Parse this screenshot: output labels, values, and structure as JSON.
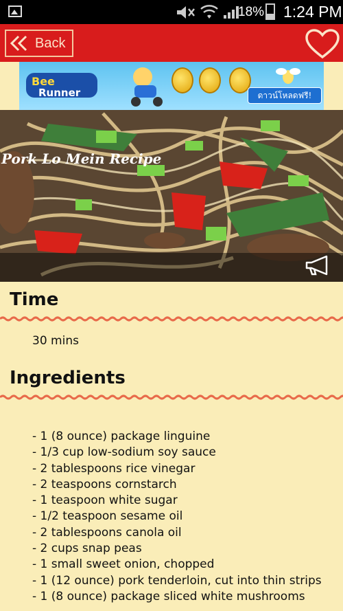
{
  "status": {
    "battery": "18%",
    "time": "1:24 PM"
  },
  "appbar": {
    "back_label": "Back"
  },
  "banner": {
    "game": "Bee Runner",
    "cta": "ดาวน์โหลดฟรี!"
  },
  "recipe": {
    "title": "Pork Lo Mein Recipe",
    "time_heading": "Time",
    "time_value": "30 mins",
    "ingredients_heading": "Ingredients",
    "ingredients": [
      "1 (8 ounce) package linguine",
      "1/3 cup low-sodium soy sauce",
      "2 tablespoons rice vinegar",
      "2 teaspoons cornstarch",
      "1 teaspoon white sugar",
      "1/2 teaspoon sesame oil",
      "2 tablespoons canola oil",
      "2 cups snap peas",
      "1 small sweet onion, chopped",
      "1 (12 ounce) pork tenderloin, cut into thin strips",
      "1 (8 ounce) package sliced white mushrooms"
    ]
  },
  "colors": {
    "accent": "#d81c1c",
    "background": "#faedb8",
    "wave": "#e86a4a"
  }
}
